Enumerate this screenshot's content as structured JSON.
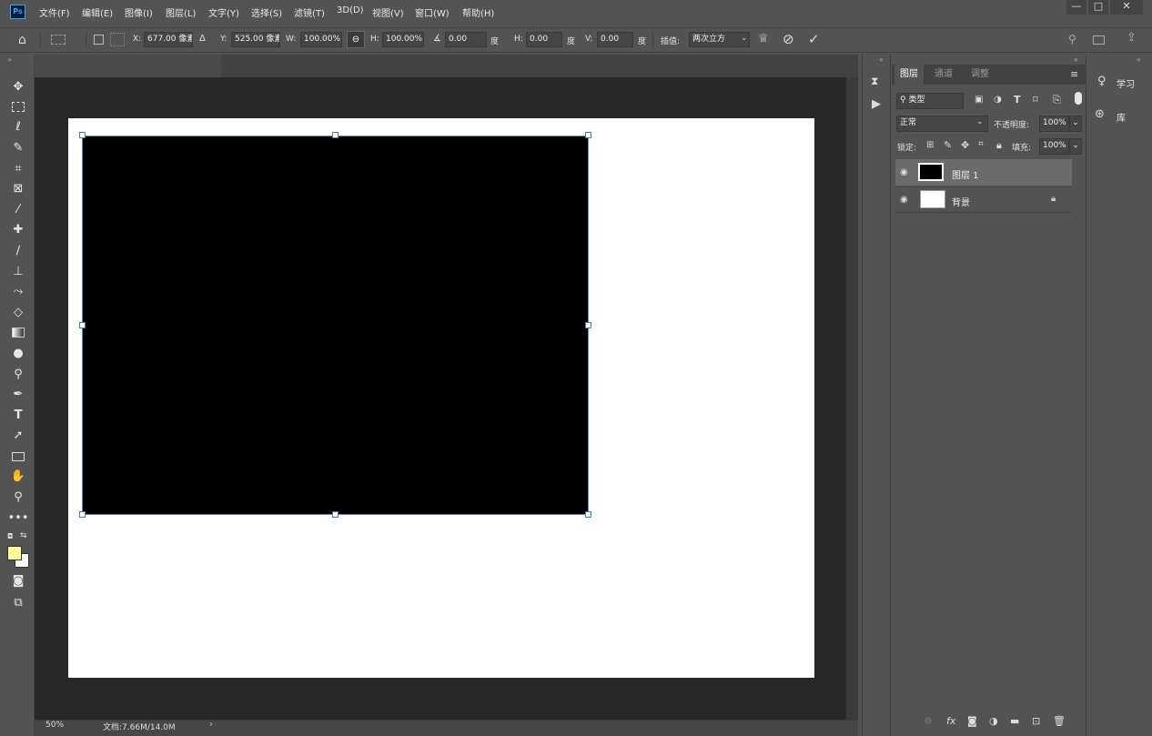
{
  "app": {
    "logo": "Ps"
  },
  "menu": [
    "文件(F)",
    "编辑(E)",
    "图像(I)",
    "图层(L)",
    "文字(Y)",
    "选择(S)",
    "滤镜(T)",
    "3D(D)",
    "视图(V)",
    "窗口(W)",
    "帮助(H)"
  ],
  "window_controls": {
    "minimize": "—",
    "restore": "□",
    "close": "✕"
  },
  "options": {
    "x_label": "X:",
    "x_value": "677.00 像素",
    "delta_icon": "Δ",
    "y_label": "Y:",
    "y_value": "525.00 像素",
    "w_label": "W:",
    "w_value": "100.00%",
    "h_label": "H:",
    "h_value": "100.00%",
    "angle_value": "0.00",
    "angle_unit": "度",
    "hskew_label": "H:",
    "hskew_value": "0.00",
    "hskew_unit": "度",
    "vskew_label": "V:",
    "vskew_value": "0.00",
    "vskew_unit": "度",
    "interp_label": "插值:",
    "interp_value": "两次立方"
  },
  "status": {
    "zoom": "50%",
    "doc_info": "文档:7.66M/14.0M",
    "arrow": "›"
  },
  "layers_panel": {
    "tabs": [
      "图层",
      "通道",
      "调整"
    ],
    "filter_label": "类型",
    "blend_mode": "正常",
    "opacity_label": "不透明度:",
    "opacity_value": "100%",
    "lock_label": "锁定:",
    "fill_label": "填充:",
    "fill_value": "100%",
    "layers": [
      {
        "name": "图层 1",
        "selected": true
      },
      {
        "name": "背景",
        "selected": false,
        "locked": true
      }
    ]
  },
  "right_panel": {
    "learn": "学习",
    "library": "库"
  },
  "colors": {
    "foreground": "#ffff99",
    "background": "#ffffff",
    "selection_border": "#5f87c3"
  }
}
